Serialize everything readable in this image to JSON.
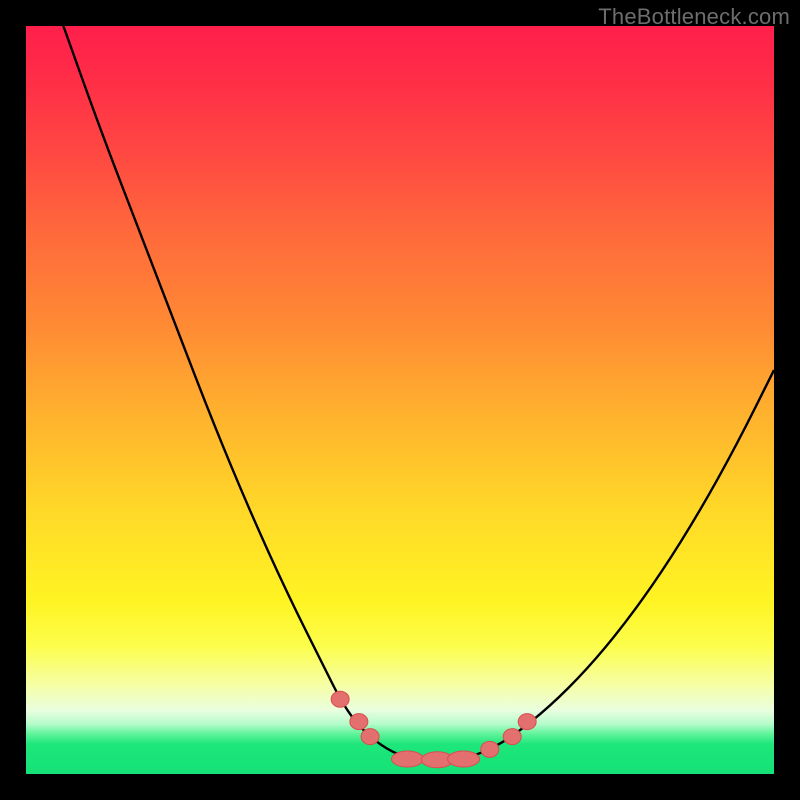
{
  "watermark": "TheBottleneck.com",
  "chart_data": {
    "type": "line",
    "title": "",
    "xlabel": "",
    "ylabel": "",
    "xlim": [
      0,
      100
    ],
    "ylim": [
      0,
      100
    ],
    "series": [
      {
        "name": "bottleneck-curve",
        "x": [
          0,
          5,
          10,
          15,
          20,
          25,
          30,
          35,
          40,
          42,
          44,
          46,
          48,
          50,
          52,
          54,
          56,
          58,
          60,
          62,
          65,
          70,
          75,
          80,
          85,
          90,
          95,
          100
        ],
        "values": [
          114,
          100,
          86,
          73,
          60,
          47,
          35,
          24,
          14,
          10,
          7,
          5,
          3.5,
          2.5,
          2,
          1.9,
          1.9,
          2,
          2.5,
          3.3,
          5,
          9,
          14,
          20,
          27,
          35,
          44,
          54
        ]
      }
    ],
    "markers": [
      {
        "x": 42,
        "y": 10
      },
      {
        "x": 44.5,
        "y": 7
      },
      {
        "x": 46,
        "y": 5
      },
      {
        "x": 51,
        "y": 2
      },
      {
        "x": 55,
        "y": 1.9
      },
      {
        "x": 58.5,
        "y": 2
      },
      {
        "x": 62,
        "y": 3.3
      },
      {
        "x": 65,
        "y": 5
      },
      {
        "x": 67,
        "y": 7
      }
    ],
    "colors": {
      "curve": "#000000",
      "marker_fill": "#e46f6f",
      "marker_stroke": "#d94e4e",
      "gradient_top": "#ff1f4b",
      "gradient_bottom": "#14e277",
      "frame": "#000000"
    }
  }
}
